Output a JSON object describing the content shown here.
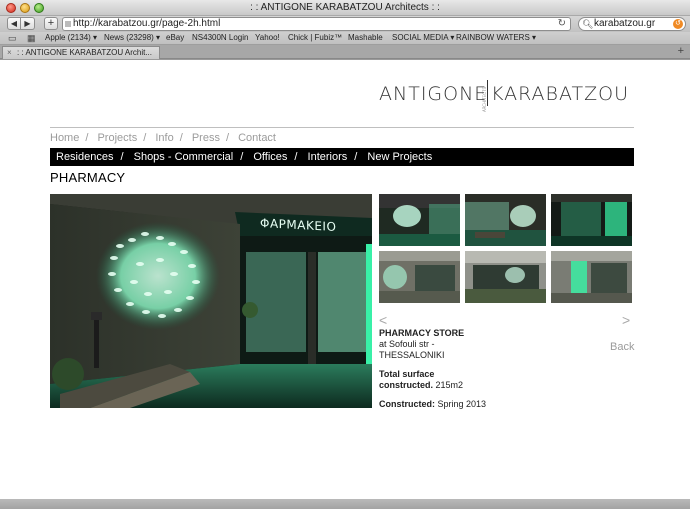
{
  "window": {
    "title": ": : ANTIGONE KARABATZOU Architects : :"
  },
  "toolbar": {
    "url": "http://karabatzou.gr/page-2h.html",
    "search_value": "karabatzou.gr",
    "back_icon": "back-arrow-icon",
    "forward_icon": "forward-arrow-icon"
  },
  "bookmarks": {
    "items": [
      "Apple (2134) ▾",
      "News (23298) ▾",
      "eBay",
      "NS4300N Login",
      "Yahoo!",
      "Chick | Fubiz™",
      "Mashable",
      "SOCIAL MEDIA ▾",
      "RAINBOW WATERS ▾"
    ]
  },
  "tab": {
    "label": ": : ANTIGONE KARABATZOU Archit..."
  },
  "logo": {
    "first": "ANTIGONE",
    "sub": "ARCHITECTS",
    "second": "KARABATZOU"
  },
  "topnav": [
    "Home",
    "Projects",
    "Info",
    "Press",
    "Contact"
  ],
  "categories": [
    "Residences",
    "Shops - Commercial",
    "Offices",
    "Interiors",
    "New Projects"
  ],
  "page_title": "PHARMACY",
  "photo": {
    "sign_text": "ΦΑΡΜΑΚΕΙΟ",
    "accent": "#2de3a0"
  },
  "project": {
    "name": "PHARMACY STORE",
    "address_line1": "at Sofouli str -",
    "address_line2": "THESSALONIKI",
    "surface_label_1": "Total surface",
    "surface_label_2": "constructed.",
    "surface_value": "215m2",
    "constructed_label": "Constructed:",
    "constructed_value": "Spring 2013"
  },
  "gallery": {
    "prev": "<",
    "next": ">",
    "back": "Back"
  }
}
